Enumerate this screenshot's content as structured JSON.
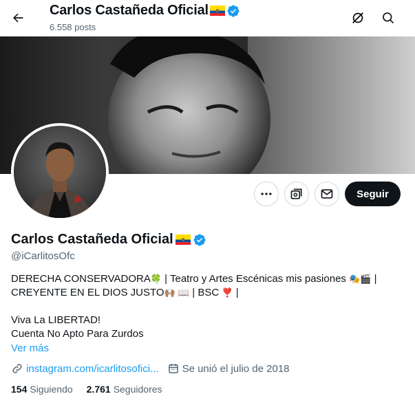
{
  "header": {
    "title": "Carlos Castañeda Oficial",
    "posts_count": "6.558 posts"
  },
  "profile": {
    "display_name": "Carlos Castañeda Oficial",
    "handle": "@iCarlitosOfc",
    "follow_label": "Seguir",
    "flag_country": "Ecuador",
    "verified": true
  },
  "bio": {
    "line1_a": "DERECHA CONSERVADORA",
    "line1_b": " | Teatro y Artes Escénicas mis pasiones ",
    "line1_c": " |",
    "line2_a": "CREYENTE EN EL DIOS JUSTO",
    "line2_b": " | BSC ",
    "line2_c": " |",
    "line3": "Viva La LIBERTAD!",
    "line4": "Cuenta No Apto Para Zurdos",
    "emoji_clover": "🍀",
    "emoji_masks": "🎭",
    "emoji_clapper": "🎬",
    "emoji_hands": "🙌🏽",
    "emoji_book": "📖",
    "emoji_heart": "❣️"
  },
  "see_more": "Ver más",
  "meta": {
    "link_text": "instagram.com/icarlitosofici...",
    "joined_text": "Se unió el julio de 2018"
  },
  "stats": {
    "following_count": "154",
    "following_label": "Siguiendo",
    "followers_count": "2.761",
    "followers_label": "Seguidores"
  },
  "colors": {
    "accent": "#1d9bf0",
    "text": "#0f1419",
    "muted": "#536471",
    "verified": "#1d9bf0",
    "follow_bg": "#0f1419"
  },
  "icons": [
    "back-arrow-icon",
    "grok-icon",
    "search-icon",
    "more-icon",
    "subscribe-icon",
    "message-icon",
    "link-icon",
    "calendar-icon",
    "verified-icon",
    "flag-icon"
  ]
}
